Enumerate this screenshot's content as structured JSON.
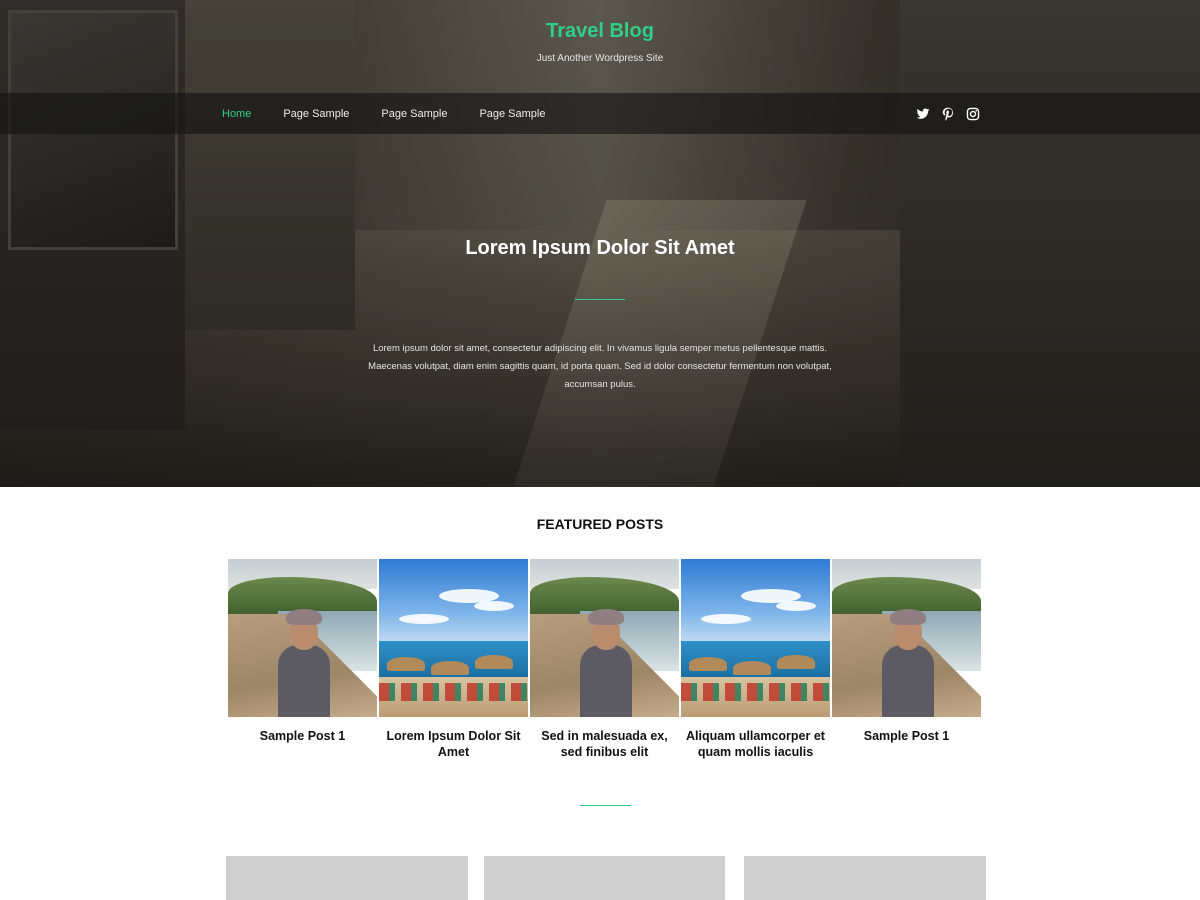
{
  "site": {
    "title": "Travel Blog",
    "tagline": "Just Another Wordpress Site"
  },
  "nav": {
    "items": [
      {
        "label": "Home",
        "active": true
      },
      {
        "label": "Page Sample",
        "active": false
      },
      {
        "label": "Page Sample",
        "active": false
      },
      {
        "label": "Page Sample",
        "active": false
      }
    ],
    "social": [
      "twitter-icon",
      "pinterest-icon",
      "instagram-icon"
    ]
  },
  "hero": {
    "heading": "Lorem Ipsum Dolor Sit Amet",
    "text": "Lorem ipsum dolor sit amet, consectetur adipiscing elit. In vivamus ligula semper metus pellentesque mattis. Maecenas volutpat, diam enim sagittis quam, id porta quam. Sed id dolor consectetur fermentum non volutpat, accumsan pulus."
  },
  "featured": {
    "title": "FEATURED POSTS",
    "posts": [
      {
        "title": "Sample Post 1",
        "image": "beach-woman-photo"
      },
      {
        "title": "Lorem Ipsum Dolor Sit Amet",
        "image": "beach-resort-photo"
      },
      {
        "title": "Sed in malesuada ex, sed finibus elit",
        "image": "beach-woman-photo"
      },
      {
        "title": "Aliquam ullamcorper et quam mollis iaculis",
        "image": "beach-resort-photo"
      },
      {
        "title": "Sample Post 1",
        "image": "beach-woman-photo"
      }
    ]
  },
  "colors": {
    "accent": "#2fcf86",
    "nav_bg": "#141414",
    "card_placeholder": "#cfcfcf"
  }
}
